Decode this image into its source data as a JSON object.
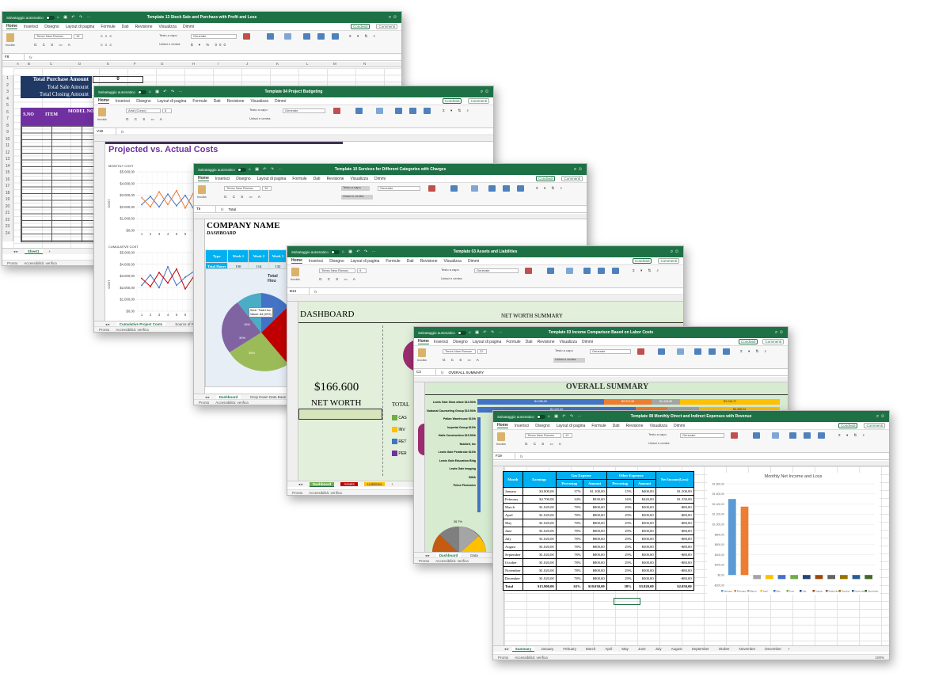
{
  "ribbon_tabs": [
    "Home",
    "Inserisci",
    "Disegno",
    "Layout di pagina",
    "Formule",
    "Dati",
    "Revisione",
    "Visualizza",
    "Dimmi"
  ],
  "autosave": "Salvataggio automatico",
  "share": "Condividi",
  "comments": "Commenti",
  "status_ready": "Pronto",
  "status_access": "Accessibilità: verifica",
  "ribbon_labels": {
    "paste": "Incolla",
    "wrap": "Testo a capo",
    "merge": "Unisci e centra",
    "number_format": "Generale",
    "cond_format": "Formattazione condizionale",
    "format_table": "Formatta come tabella",
    "cell_styles": "Stili cella",
    "insert": "Inserisci",
    "delete": "Elimina",
    "format": "Formato",
    "sort": "Ordina e filtra",
    "find": "Trova e seleziona"
  },
  "win1": {
    "title": "Template 13 Stock Sale and Purchase with Profit and Loss",
    "font": "Times New Roman",
    "size": "15",
    "cell": "F8",
    "columns": [
      "A",
      "B",
      "C",
      "D",
      "E",
      "F",
      "G",
      "H",
      "I",
      "J",
      "K",
      "L",
      "M",
      "N"
    ],
    "rows": [
      "1",
      "2",
      "3",
      "4",
      "5",
      "6",
      "7",
      "8",
      "9",
      "10",
      "11",
      "12",
      "13",
      "14",
      "15",
      "16",
      "17",
      "18",
      "19",
      "20",
      "21",
      "22",
      "23",
      "24"
    ],
    "total_purchase": "Total Purchase Amount",
    "total_sale": "Total Sale Amount",
    "total_closing": "Total Closing Amount",
    "total_value": "0",
    "headers": [
      "S.NO",
      "ITEM",
      "MODEL NO.",
      "C"
    ],
    "sheet": "Sheet1"
  },
  "win2": {
    "title": "Template 04 Project Budgeting",
    "font": "Arial (Corpo)",
    "size": "8",
    "cell": "V18",
    "heading": "Projected vs. Actual Costs",
    "chart1_title": "MONTHLY COST",
    "chart2_title": "CUMULATIVE COST",
    "ylabel": "COST",
    "tabs": [
      "Cumulative Project Costs",
      "Source of Proj"
    ]
  },
  "win3": {
    "title": "Template 10 Services for Different Categories with Charges",
    "font": "Times New Roman",
    "size": "16",
    "cell": "T6",
    "formula": "Total",
    "company": "COMPANY NAME",
    "dashboard": "DASHBOARD",
    "table_headers": [
      "Type",
      "Week 1",
      "Week 2",
      "Week 3"
    ],
    "table_row": [
      "Total Hours",
      "150",
      "114",
      "132"
    ],
    "chart_title": "Total Hou",
    "tooltip1": "Serie \"Total Hou",
    "tooltip2": "Valore: 84 (10%)",
    "pie_labels": [
      "16%",
      "38%",
      "30%"
    ],
    "tabs": [
      "Dashboard",
      "Drop Down Data Base"
    ]
  },
  "win4": {
    "title": "Template 03 Assets and Liabilities",
    "font": "Times New Roman",
    "size": "9",
    "cell": "B13",
    "dashboard": "DASHBOARD",
    "net_worth_summary": "NET WORTH SUMMARY",
    "amount": "$166.600",
    "net_worth": "NET WORTH",
    "total": "TOTAL",
    "legend": [
      "CAS",
      "INV",
      "RET",
      "PER"
    ],
    "tabs": [
      "Dashboard",
      "Assets",
      "Liabilities"
    ]
  },
  "win5": {
    "title": "Template 03 Income Comparison Based on Labor Costs",
    "font": "Times New Roman",
    "size": "22",
    "cell": "C3",
    "formula": "OVERALL SUMMARY",
    "heading": "OVERALL SUMMARY",
    "companies": [
      "Lewis Gale Sima ofane $10.50/h",
      "Nubonal Counseling Group $10.50/h",
      "Pallan Warehouse $10/h",
      "Imperial Group $10/h",
      "Halls Construction $10.50/h",
      "Nubbell, Inc",
      "Lewis Gale Pembroke $10/h",
      "Lewis Gale Education Bldg",
      "Lewis Gale Imaging",
      "SIMA",
      "Prime Photonics"
    ],
    "bar_values": [
      "$4.280,00",
      "$2.513,38",
      "$1.428,06",
      "$4.120,00",
      "$3.246,72",
      "$4.456,24"
    ],
    "pie_label": "26.7%",
    "tabs": [
      "Dashboard",
      "Data"
    ]
  },
  "win6": {
    "title": "Template 08 Monthly Direct and Indirect Expenses with Revenue",
    "font": "Times New Roman",
    "size": "12",
    "cell": "F19",
    "group_headers": [
      "Gas Expense",
      "Other Expenses"
    ],
    "headers": [
      "Month",
      "Earnings",
      "Percentag",
      "Amount",
      "Percentag",
      "Amount",
      "Net Income(Loss)"
    ],
    "rows": [
      [
        "January",
        "$3.000,00",
        "37%",
        "$1.100,00",
        "15%",
        "$400,00",
        "$1.500,00"
      ],
      [
        "February",
        "$2.700,00",
        "34%",
        "$930,00",
        "16%",
        "$420,00",
        "$1.350,00"
      ],
      [
        "March",
        "$1.020,00",
        "78%",
        "$800,00",
        "29%",
        "$300,00",
        "-$80,00"
      ],
      [
        "April",
        "$1.020,00",
        "78%",
        "$800,00",
        "29%",
        "$300,00",
        "-$80,00"
      ],
      [
        "May",
        "$1.020,00",
        "78%",
        "$800,00",
        "29%",
        "$300,00",
        "-$80,00"
      ],
      [
        "June",
        "$1.020,00",
        "78%",
        "$800,00",
        "29%",
        "$300,00",
        "-$80,00"
      ],
      [
        "July",
        "$1.020,00",
        "78%",
        "$800,00",
        "29%",
        "$300,00",
        "-$80,00"
      ],
      [
        "August",
        "$1.020,00",
        "78%",
        "$800,00",
        "29%",
        "$300,00",
        "-$80,00"
      ],
      [
        "September",
        "$1.020,00",
        "78%",
        "$800,00",
        "29%",
        "$300,00",
        "-$80,00"
      ],
      [
        "October",
        "$1.020,00",
        "78%",
        "$800,00",
        "29%",
        "$300,00",
        "-$80,00"
      ],
      [
        "November",
        "$1.020,00",
        "78%",
        "$800,00",
        "29%",
        "$300,00",
        "-$80,00"
      ],
      [
        "December",
        "$1.020,00",
        "78%",
        "$800,00",
        "29%",
        "$300,00",
        "-$80,00"
      ]
    ],
    "total": [
      "Total",
      "$15.900,00",
      "63%",
      "$10.030,00",
      "38%",
      "$3.820,00",
      "$2.050,00"
    ],
    "chart_title": "Monthly Net Income and Loss",
    "yticks": [
      "$1.800,00",
      "$1.600,00",
      "$1.400,00",
      "$1.200,00",
      "$1.000,00",
      "$800,00",
      "$600,00",
      "$400,00",
      "$200,00",
      "$0,00",
      "-$200,00"
    ],
    "tabs": [
      "Summary",
      "January",
      "Febuary",
      "March",
      "April",
      "May",
      "June",
      "July",
      "August",
      "September",
      "Otober",
      "November",
      "December"
    ],
    "zoom": "100%"
  },
  "chart_data": [
    {
      "type": "bar",
      "title": "Monthly Net Income and Loss",
      "categories": [
        "January",
        "February",
        "March",
        "April",
        "May",
        "June",
        "July",
        "August",
        "September",
        "October",
        "November",
        "December"
      ],
      "values": [
        1500,
        1350,
        -80,
        -80,
        -80,
        -80,
        -80,
        -80,
        -80,
        -80,
        -80,
        -80
      ],
      "ylim": [
        -200,
        1800
      ],
      "colors": [
        "#5b9bd5",
        "#ed7d31",
        "#a5a5a5",
        "#ffc000",
        "#4472c4",
        "#70ad47",
        "#264478",
        "#9e480e",
        "#636363",
        "#997300",
        "#255e91",
        "#43682b"
      ]
    },
    {
      "type": "line",
      "title": "MONTHLY COST",
      "ylabel": "COST",
      "x": [
        1,
        2,
        3,
        4,
        5,
        6,
        7,
        8,
        9,
        10
      ],
      "yticks": [
        "$5.000,00",
        "$4.000,00",
        "$3.000,00",
        "$2.000,00",
        "$1.000,00",
        "$0,00"
      ],
      "ylim": [
        0,
        5000
      ],
      "series": [
        {
          "color": "#4472c4",
          "values": [
            2200,
            2900,
            2000,
            3100,
            2100,
            3000,
            1800,
            2800,
            2000,
            2300
          ]
        },
        {
          "color": "#ed7d31",
          "values": [
            2800,
            2000,
            3300,
            2200,
            3400,
            1900,
            3300,
            2100,
            3200,
            1900
          ]
        }
      ]
    },
    {
      "type": "line",
      "title": "CUMULATIVE COST",
      "ylabel": "COST",
      "x": [
        1,
        2,
        3,
        4,
        5,
        6,
        7,
        8,
        9,
        10
      ],
      "yticks": [
        "$5.000,00",
        "$4.000,00",
        "$3.000,00",
        "$2.000,00",
        "$1.000,00",
        "$0,00"
      ],
      "ylim": [
        0,
        5000
      ],
      "series": [
        {
          "color": "#4472c4",
          "values": [
            2200,
            3100,
            2000,
            3800,
            2200,
            2900,
            3400,
            2100,
            3000,
            2300
          ]
        },
        {
          "color": "#c00000",
          "values": [
            2800,
            2100,
            3300,
            2400,
            3600,
            1900,
            3000,
            2600,
            3500,
            2000
          ]
        }
      ]
    }
  ]
}
